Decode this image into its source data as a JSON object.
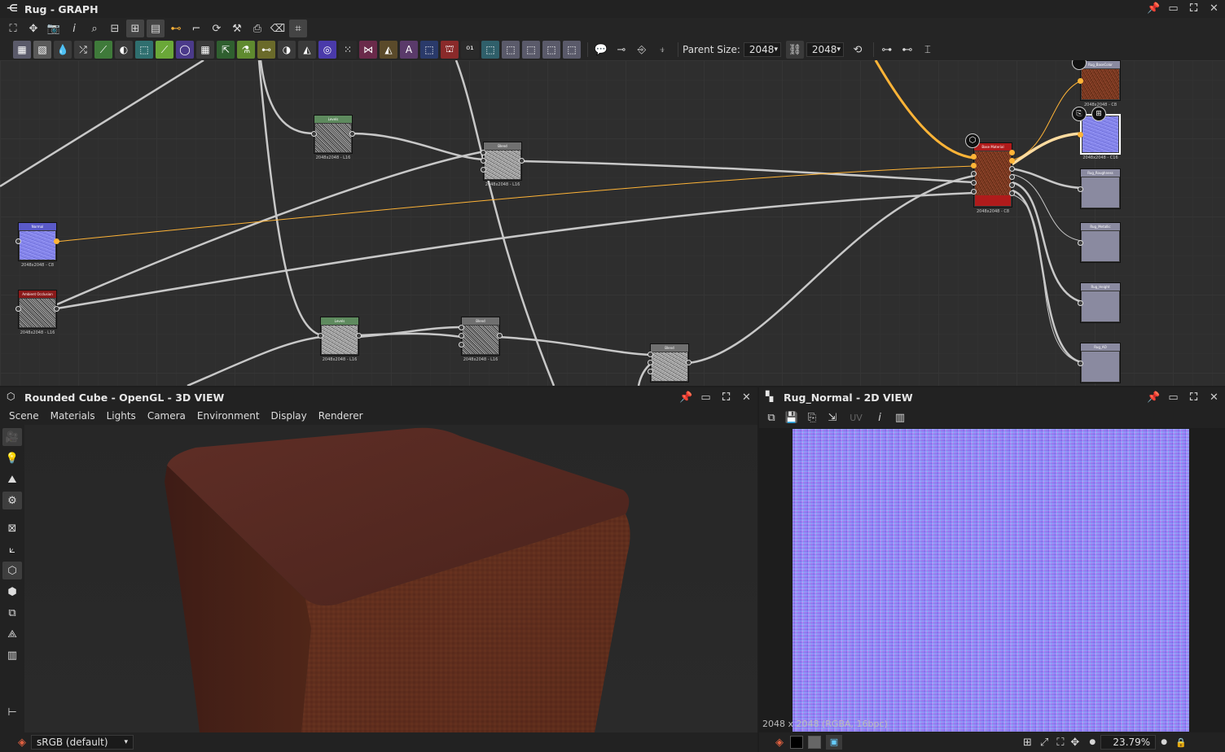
{
  "graph": {
    "title": "Rug - GRAPH",
    "parent_size_label": "Parent Size:",
    "parent_size_value": "2048",
    "size_value_2": "2048",
    "nodes": {
      "levels1": {
        "title": "Levels",
        "info": "2048x2048 - L16"
      },
      "blend1": {
        "title": "Blend",
        "info": "2048x2048 - L16"
      },
      "normal": {
        "title": "Normal",
        "info": "2048x2048 - C8"
      },
      "ao": {
        "title": "Ambient Occlusion (RTAO)",
        "info": "2048x2048 - L16"
      },
      "levels2": {
        "title": "Levels",
        "info": "2048x2048 - L16"
      },
      "blend2": {
        "title": "Blend",
        "info": "2048x2048 - L16"
      },
      "blend3": {
        "title": "Blend",
        "info": ""
      },
      "base_material": {
        "title": "Base Material",
        "info": "2048x2048 - C8"
      },
      "out_basecolor": {
        "title": "Rug_BaseColor",
        "info": "2048x2048 - C8"
      },
      "out_normal": {
        "title": "",
        "info": "2048x2048 - C16"
      },
      "out_roughness": {
        "title": "Rug_Roughness",
        "info": ""
      },
      "out_metallic": {
        "title": "Rug_Metallic",
        "info": ""
      },
      "out_height": {
        "title": "Rug_Height",
        "info": ""
      },
      "out_ao": {
        "title": "Rug_AO",
        "info": ""
      }
    }
  },
  "view3d": {
    "title": "Rounded Cube - OpenGL - 3D VIEW",
    "menu": [
      "Scene",
      "Materials",
      "Lights",
      "Camera",
      "Environment",
      "Display",
      "Renderer"
    ],
    "colorspace": "sRGB (default)"
  },
  "view2d": {
    "title": "Rug_Normal - 2D VIEW",
    "uv_label": "UV",
    "resolution_label": "2048 x 2048 (RGBA, 16bpc)",
    "zoom": "23.79%"
  },
  "colors": {
    "orange_link": "#ffb437",
    "gray_link": "#c8c8c8",
    "levels_header": "#5e8a5e",
    "base_material_header": "#b01b1b",
    "ao_header": "#8a1a1a",
    "normal_header": "#5a5ac8"
  }
}
